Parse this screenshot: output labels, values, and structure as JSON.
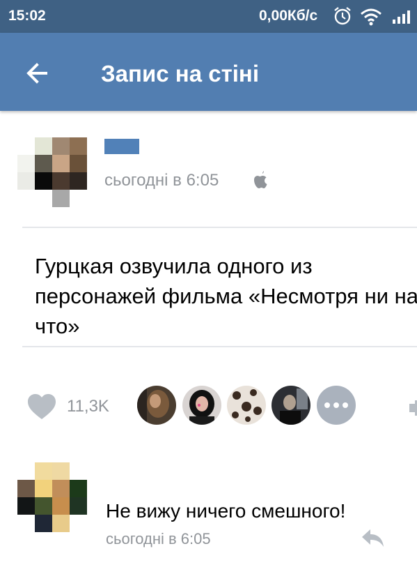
{
  "status_bar": {
    "time": "15:02",
    "network_speed": "0,00Кб/с",
    "icons": [
      "alarm-icon",
      "wifi-icon",
      "signal-icon"
    ]
  },
  "app_bar": {
    "title": "Запис на стіні",
    "back_icon": "arrow-left-icon",
    "background_color": "#527eb1"
  },
  "post": {
    "timestamp": "сьогодні в 6:05",
    "platform_icon": "apple-icon",
    "text": "Гурцкая озвучила одного из персонажей фильма «Несмотря ни на что»",
    "likes": {
      "count": "11,3K",
      "icon": "heart-icon",
      "more_icon": "ellipsis-icon"
    }
  },
  "comment": {
    "text": "Не вижу ничего смешного!",
    "timestamp": "сьогодні в 6:05",
    "reply_icon": "reply-icon"
  },
  "colors": {
    "status_bar": "#3f6184",
    "app_bar": "#527eb1",
    "link_blue": "#5181b8",
    "secondary_text": "#909499",
    "divider": "#e4e6ea"
  }
}
